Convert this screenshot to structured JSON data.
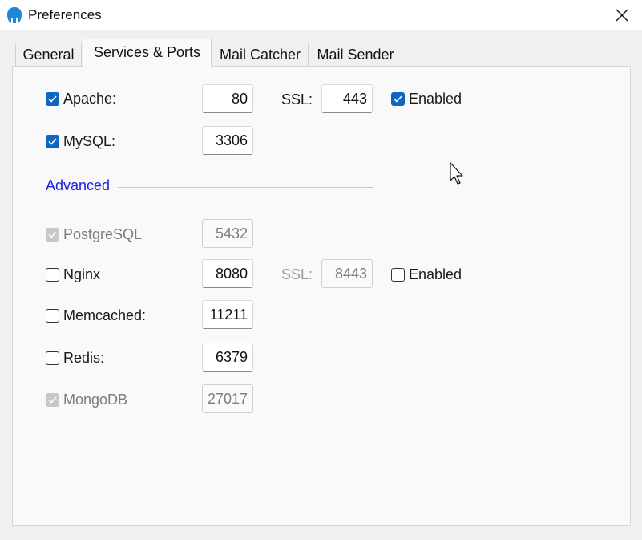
{
  "window": {
    "title": "Preferences"
  },
  "tabs": [
    {
      "label": "General"
    },
    {
      "label": "Services & Ports"
    },
    {
      "label": "Mail Catcher"
    },
    {
      "label": "Mail Sender"
    }
  ],
  "active_tab": "Services & Ports",
  "services": {
    "apache": {
      "label": "Apache:",
      "checked": true,
      "port": "80",
      "ssl_label": "SSL:",
      "ssl_port": "443",
      "ssl_enabled_label": "Enabled",
      "ssl_enabled": true
    },
    "mysql": {
      "label": "MySQL:",
      "checked": true,
      "port": "3306"
    }
  },
  "advanced": {
    "heading": "Advanced",
    "postgresql": {
      "label": "PostgreSQL",
      "checked": true,
      "disabled": true,
      "port": "5432"
    },
    "nginx": {
      "label": "Nginx",
      "checked": false,
      "port": "8080",
      "ssl_label": "SSL:",
      "ssl_port": "8443",
      "ssl_enabled_label": "Enabled",
      "ssl_enabled": false
    },
    "memcached": {
      "label": "Memcached:",
      "checked": false,
      "port": "11211"
    },
    "redis": {
      "label": "Redis:",
      "checked": false,
      "port": "6379"
    },
    "mongodb": {
      "label": "MongoDB",
      "checked": true,
      "disabled": true,
      "port": "27017"
    }
  },
  "colors": {
    "accent": "#0f66c2",
    "advanced_heading": "#2020e0",
    "disabled_text": "#7d7d7d"
  }
}
